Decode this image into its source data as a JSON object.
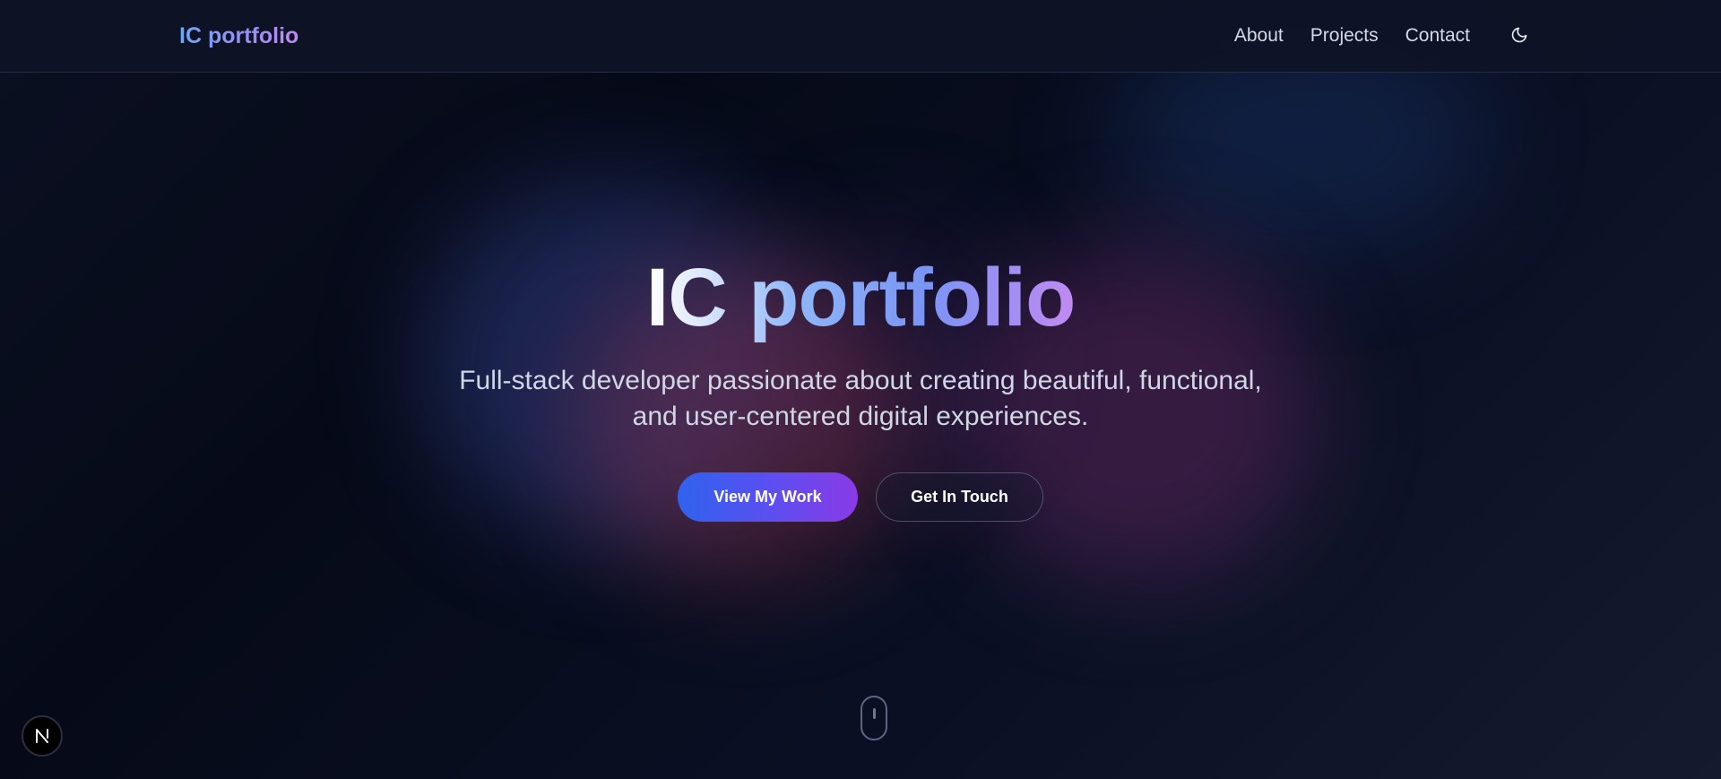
{
  "nav": {
    "brand": "IC portfolio",
    "links": [
      "About",
      "Projects",
      "Contact"
    ],
    "theme_icon": "moon-icon"
  },
  "hero": {
    "title": "IC portfolio",
    "subtitle": "Full-stack developer passionate about creating beautiful, functional, and user-centered digital experiences.",
    "primary_cta": "View My Work",
    "secondary_cta": "Get In Touch"
  },
  "scroll_indicator_icon": "mouse-scroll-icon",
  "badge_icon": "nextjs-icon",
  "colors": {
    "background": "#070b18",
    "accent_blue": "#2f63ee",
    "accent_purple": "#8a3ae6",
    "brand_gradient_start": "#6ea6f7",
    "brand_gradient_end": "#c08af2",
    "nav_text": "#d3d9e6"
  }
}
